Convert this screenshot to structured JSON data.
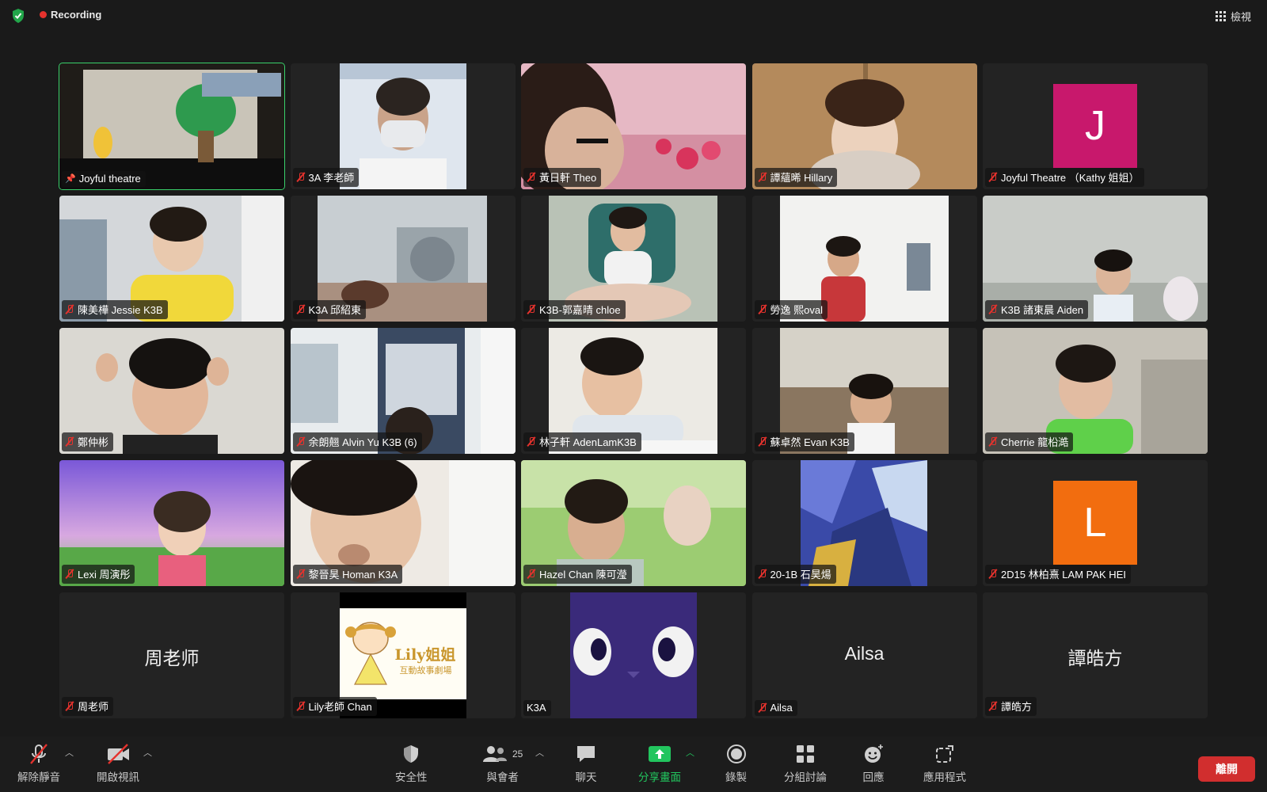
{
  "topbar": {
    "recording_label": "Recording",
    "view_label": "檢視"
  },
  "tiles": [
    {
      "name": "Joyful theatre"
    },
    {
      "name": "3A 李老師"
    },
    {
      "name": "黃日軒 Theo"
    },
    {
      "name": "譚蘊晞 Hillary"
    },
    {
      "name": "Joyful Theatre （Kathy 姐姐）",
      "avatar_letter": "J",
      "avatar_color": "#c8186c"
    },
    {
      "name": "陳美樺 Jessie K3B"
    },
    {
      "name": "K3A 邱紹東"
    },
    {
      "name": "K3B-郭嘉晴 chloe"
    },
    {
      "name": "勞逸 熙oval"
    },
    {
      "name": "K3B 諸東晨 Aiden"
    },
    {
      "name": "鄭仲彬"
    },
    {
      "name": "余朗翹 Alvin Yu K3B (6)"
    },
    {
      "name": "林子軒 AdenLamK3B"
    },
    {
      "name": "蘇卓然 Evan K3B"
    },
    {
      "name": "Cherrie 龍柗澔"
    },
    {
      "name": "Lexi 周演彤"
    },
    {
      "name": "黎晉昊 Homan K3A"
    },
    {
      "name": "Hazel Chan 陳可瀅"
    },
    {
      "name": "20-1B 石昊煬"
    },
    {
      "name": "2D15 林柏熹 LAM PAK HEI",
      "avatar_letter": "L",
      "avatar_color": "#f26d0f"
    },
    {
      "name": "周老师",
      "display_name": "周老师"
    },
    {
      "name": "Lily老師 Chan",
      "logo_text": "Lily姐姐",
      "logo_subtext": "互動故事劇場"
    },
    {
      "name": "K3A"
    },
    {
      "name": "Ailsa",
      "display_name": "Ailsa"
    },
    {
      "name": "譚皓方",
      "display_name": "譚皓方"
    }
  ],
  "toolbar": {
    "unmute": "解除靜音",
    "start_video": "開啟視訊",
    "security": "安全性",
    "participants": "與會者",
    "participants_count": "25",
    "chat": "聊天",
    "share_screen": "分享畫面",
    "record": "錄製",
    "breakout": "分組討論",
    "reactions": "回應",
    "apps": "應用程式",
    "leave": "離開"
  },
  "colors": {
    "active_speaker": "#39d16b",
    "muted": "#e5322d",
    "share": "#22c55e",
    "leave": "#d12e2e"
  }
}
